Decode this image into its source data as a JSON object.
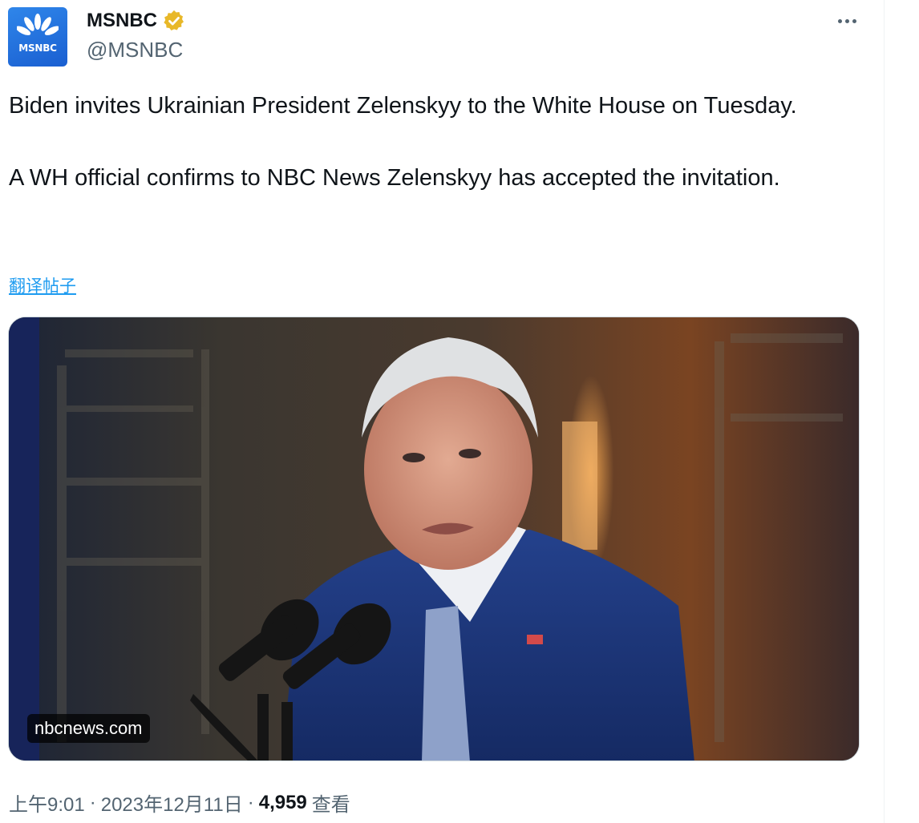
{
  "account": {
    "display_name": "MSNBC",
    "handle": "@MSNBC",
    "avatar_text": "MSNBC",
    "verified": true,
    "verified_badge_color": "#e8b829"
  },
  "more_icon": "more-horizontal-icon",
  "tweet": {
    "paragraphs": [
      "Biden invites Ukrainian President Zelenskyy to the White House on Tuesday.",
      "A WH official confirms to NBC News Zelenskyy has accepted the invitation."
    ],
    "translate_label": "翻译帖子"
  },
  "media": {
    "source_label": "nbcnews.com"
  },
  "meta": {
    "time": "上午9:01",
    "separator": "·",
    "date": "2023年12月11日",
    "views_count": "4,959",
    "views_label": "查看"
  },
  "colors": {
    "link": "#1d9bf0",
    "secondary_text": "#536471",
    "primary_text": "#0f1419",
    "avatar_blue": "#1a5fd1"
  }
}
